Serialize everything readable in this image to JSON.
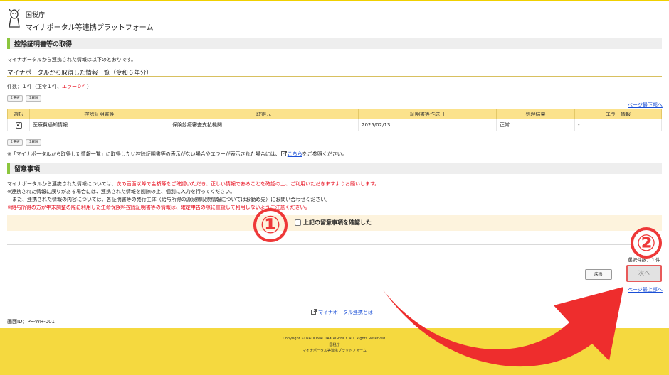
{
  "header": {
    "agency": "国税庁",
    "platform_name": "マイナポータル等連携プラットフォーム"
  },
  "section1": {
    "title": "控除証明書等の取得",
    "intro": "マイナポータルから連携された情報は以下のとおりです。",
    "subtitle": "マイナポータルから取得した情報一覧（令和６年分）",
    "count_prefix": "件数：１件（正常１件、",
    "count_error": "エラー０件",
    "count_suffix": "）",
    "select_all": "全選択",
    "deselect_all": "全解除",
    "page_bottom_link": "ページ最下部へ",
    "table": {
      "headers": [
        "選択",
        "控除証明書等",
        "取得元",
        "証明書等作成日",
        "処理結果",
        "エラー情報"
      ],
      "rows": [
        {
          "checked": "✔",
          "cert": "医療費通知情報",
          "source": "保険診療審査支払機関",
          "date": "2025/02/13",
          "result": "正常",
          "error": "-"
        }
      ]
    },
    "note_before": "※「マイナポータルから取得した情報一覧」に取得したい控除証明書等の表示がない場合やエラーが表示された場合には、",
    "note_link": "こちら",
    "note_after": "をご参照ください。"
  },
  "section2": {
    "title": "留意事項",
    "line1_black": "マイナポータルから連携された情報については、",
    "line1_red": "次の画面以降で金額等をご確認いただき、正しい情報であることを確認の上、ご利用いただきますようお願いします。",
    "line2": "※連携された情報に誤りがある場合には、連携された情報を削除の上、個別に入力を行ってください。",
    "line3": "　また、連携された情報の内容については、各証明書等の発行主体（給与所得の源泉徴収票情報についてはお勤め先）にお問い合わせください。",
    "line4_red": "※給与所得の方が年末調整の際に利用した生命保険料控除証明書等の情報は、確定申告の際に重複して利用しないようご注意ください。",
    "confirm_label": "上記の留意事項を確認した"
  },
  "selection_count": "選択件数：１件",
  "buttons": {
    "back": "戻る",
    "next": "次へ"
  },
  "page_top_link": "ページ最上部へ",
  "about_link": "マイナポータル連携とは",
  "screen_id": "画面ID：PF-WH-001",
  "footer": {
    "copyright": "Copyright © NATIONAL TAX AGENCY ALL Rights Reserved.",
    "agency": "国税庁",
    "platform": "マイナポータル等連携プラットフォーム"
  },
  "annotations": {
    "step1": "①",
    "step2": "②",
    "color": "#ee3838"
  }
}
